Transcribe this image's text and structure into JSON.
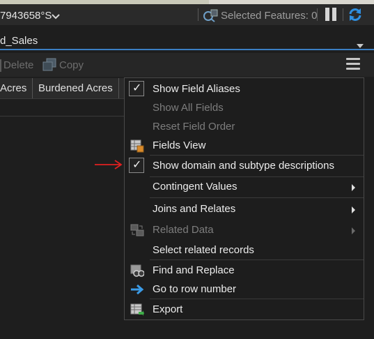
{
  "status_bar": {
    "coordinate": "7943658°S",
    "selected_features_label": "Selected Features: 0"
  },
  "table": {
    "title": "d_Sales",
    "toolbar": {
      "delete_label": "Delete",
      "copy_label": "Copy"
    },
    "columns": [
      "Acres",
      "Burdened Acres"
    ]
  },
  "context_menu": {
    "items": [
      {
        "label": "Show Field Aliases",
        "checked": true,
        "enabled": true
      },
      {
        "label": "Show All Fields",
        "enabled": false
      },
      {
        "label": "Reset Field Order",
        "enabled": false
      },
      {
        "label": "Fields View",
        "icon": "fields-view-icon",
        "enabled": true
      },
      {
        "label": "Show domain and subtype descriptions",
        "checked": true,
        "enabled": true
      },
      {
        "label": "Contingent Values",
        "submenu": true,
        "enabled": true
      },
      {
        "label": "Joins and Relates",
        "submenu": true,
        "enabled": true
      },
      {
        "label": "Related Data",
        "icon": "related-data-icon",
        "submenu": true,
        "enabled": false
      },
      {
        "label": "Select related records",
        "enabled": true
      },
      {
        "label": "Find and Replace",
        "icon": "binoculars-icon",
        "enabled": true
      },
      {
        "label": "Go to row number",
        "icon": "blue-arrow-icon",
        "enabled": true
      },
      {
        "label": "Export",
        "icon": "export-table-icon",
        "enabled": true
      }
    ]
  },
  "colors": {
    "accent_blue": "#3b7fc4",
    "annotation_red": "#e02020"
  }
}
